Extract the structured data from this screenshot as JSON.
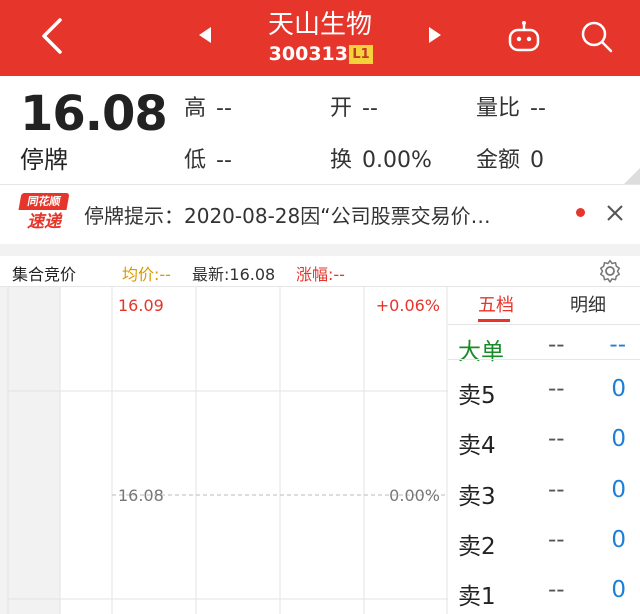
{
  "header": {
    "stock_name": "天山生物",
    "stock_code": "300313",
    "badge": "L1",
    "bg_color": "#e6352b"
  },
  "quote": {
    "price": "16.08",
    "status": "停牌",
    "high_label": "高",
    "high_value": "--",
    "open_label": "开",
    "open_value": "--",
    "vol_ratio_label": "量比",
    "vol_ratio_value": "--",
    "low_label": "低",
    "low_value": "--",
    "turnover_label": "换",
    "turnover_value": "0.00%",
    "amount_label": "金额",
    "amount_value": "0"
  },
  "notice": {
    "logo_top": "同花顺",
    "logo_bottom": "速递",
    "text": "停牌提示：2020-08-28因“公司股票交易价…"
  },
  "bar": {
    "mode": "集合竞价",
    "avg": "均价:--",
    "latest": "最新:16.08",
    "change": "涨幅:--"
  },
  "chart": {
    "top_price": "16.09",
    "top_pct": "+0.06%",
    "mid_price": "16.08",
    "mid_pct": "0.00%"
  },
  "orderbook": {
    "tab_five": "五档",
    "tab_detail": "明细",
    "rows": [
      {
        "label": "大单",
        "mid": "--",
        "right": "--"
      },
      {
        "label": "卖5",
        "mid": "--",
        "right": "0"
      },
      {
        "label": "卖4",
        "mid": "--",
        "right": "0"
      },
      {
        "label": "卖3",
        "mid": "--",
        "right": "0"
      },
      {
        "label": "卖2",
        "mid": "--",
        "right": "0"
      },
      {
        "label": "卖1",
        "mid": "--",
        "right": "0"
      }
    ]
  },
  "colors": {
    "red": "#e6352b",
    "blue": "#1e7fd6",
    "green": "#1b8a2a",
    "orange": "#d89a00"
  }
}
